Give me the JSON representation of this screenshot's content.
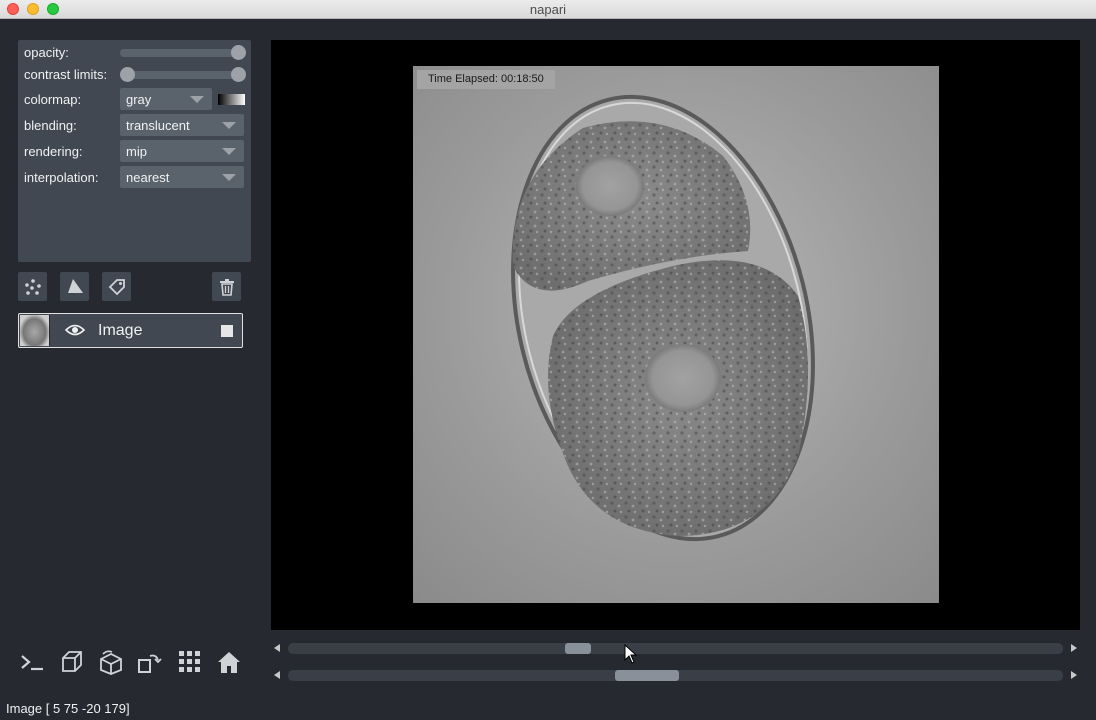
{
  "window": {
    "title": "napari"
  },
  "layer_controls": {
    "opacity_label": "opacity:",
    "opacity_value": 1.0,
    "contrast_label": "contrast limits:",
    "contrast_range": [
      0,
      1
    ],
    "colormap_label": "colormap:",
    "colormap_value": "gray",
    "blending_label": "blending:",
    "blending_value": "translucent",
    "rendering_label": "rendering:",
    "rendering_value": "mip",
    "interpolation_label": "interpolation:",
    "interpolation_value": "nearest"
  },
  "layer_buttons": [
    "new-points-icon",
    "new-shapes-icon",
    "new-labels-icon",
    "delete-layer-icon"
  ],
  "layers": [
    {
      "name": "Image",
      "visible": true
    }
  ],
  "viewer_buttons": [
    "console-icon",
    "ndisplay-icon",
    "roll-axes-icon",
    "transpose-icon",
    "grid-icon",
    "home-icon"
  ],
  "canvas": {
    "time_overlay": "Time Elapsed: 00:18:50"
  },
  "dims_sliders": [
    {
      "value_fraction": 0.37
    },
    {
      "value_fraction": 0.46
    }
  ],
  "status": {
    "text": "Image [  5  75 -20 179]"
  },
  "colors": {
    "background": "#262930",
    "panel": "#414851",
    "control": "#5a626c"
  }
}
